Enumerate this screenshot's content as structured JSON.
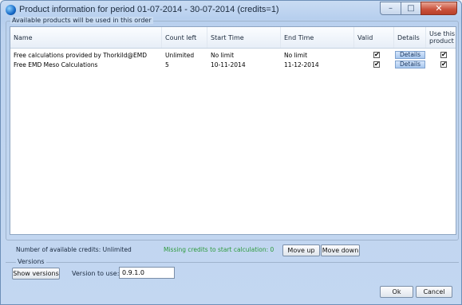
{
  "window": {
    "title": "Product information for period 01-07-2014 - 30-07-2014 (credits=1)",
    "minimize_symbol": "–",
    "maximize_symbol": "□",
    "close_symbol": "✕"
  },
  "products_group": {
    "label": "Available products will be used in this order",
    "columns": [
      "Name",
      "Count left",
      "Start Time",
      "End Time",
      "Valid",
      "Details",
      "Use this product"
    ],
    "rows": [
      {
        "name": "Free calculations provided by Thorkild@EMD",
        "count_left": "Unlimited",
        "start_time": "No limit",
        "end_time": "No limit",
        "valid": true,
        "details_label": "Details",
        "use": true
      },
      {
        "name": "Free EMD Meso Calculations",
        "count_left": "5",
        "start_time": "10-11-2014",
        "end_time": "11-12-2014",
        "valid": true,
        "details_label": "Details",
        "use": true
      }
    ]
  },
  "status": {
    "available_credits": "Number of available credits: Unlimited",
    "missing_credits": "Missing credits to start calculation: 0",
    "missing_color": "#2d9a3c"
  },
  "buttons": {
    "move_up": "Move up",
    "move_down": "Move down",
    "show_versions": "Show versions",
    "ok": "Ok",
    "cancel": "Cancel"
  },
  "versions": {
    "label": "Versions",
    "version_label": "Version to use:",
    "version_value": "0.9.1.0"
  },
  "check_symbol": "✔"
}
